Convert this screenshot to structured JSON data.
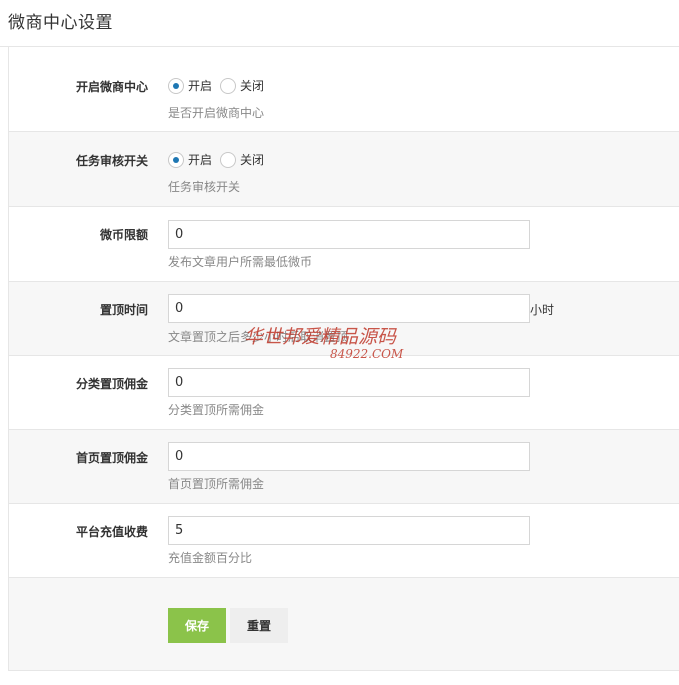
{
  "page": {
    "title": "微商中心设置"
  },
  "form": {
    "rows": [
      {
        "label": "开启微商中心",
        "type": "radio",
        "options": [
          "开启",
          "关闭"
        ],
        "selected": 0,
        "help": "是否开启微商中心"
      },
      {
        "label": "任务审核开关",
        "type": "radio",
        "options": [
          "开启",
          "关闭"
        ],
        "selected": 0,
        "help": "任务审核开关"
      },
      {
        "label": "微币限额",
        "type": "text",
        "value": "0",
        "help": "发布文章用户所需最低微币"
      },
      {
        "label": "置顶时间",
        "type": "text",
        "value": "0",
        "suffix": "小时",
        "help": "文章置顶之后多少小时后取消置顶"
      },
      {
        "label": "分类置顶佣金",
        "type": "text",
        "value": "0",
        "help": "分类置顶所需佣金"
      },
      {
        "label": "首页置顶佣金",
        "type": "text",
        "value": "0",
        "help": "首页置顶所需佣金"
      },
      {
        "label": "平台充值收费",
        "type": "text",
        "value": "5",
        "help": "充值金额百分比"
      }
    ],
    "buttons": {
      "save": "保存",
      "reset": "重置"
    }
  },
  "watermark": {
    "text": "华世邦爱精品源码",
    "url": "84922.COM"
  },
  "colors": {
    "primary": "#8bc34a",
    "radio": "#1e77b3",
    "border": "#e6e6e6",
    "alt_row": "#f7f7f7"
  }
}
